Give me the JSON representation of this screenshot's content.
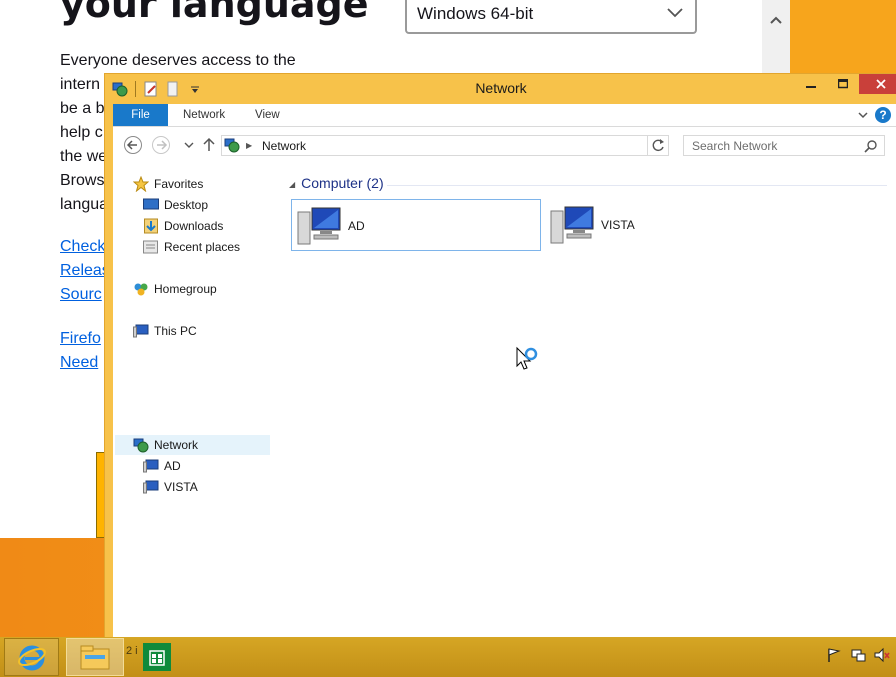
{
  "background_page": {
    "heading": "your language",
    "select_value": "Windows 64-bit",
    "paragraph_lines": [
      "Everyone deserves access to the",
      "intern",
      "be a b",
      "help c",
      "the we",
      "Brows",
      "langua"
    ],
    "links": [
      "Check",
      "Releas",
      "Sourc",
      "Firefo",
      "Need"
    ]
  },
  "window": {
    "title": "Network",
    "ribbon_tabs": {
      "file": "File",
      "network": "Network",
      "view": "View"
    },
    "help_label": "?",
    "address": {
      "location": "Network"
    },
    "search": {
      "placeholder": "Search Network"
    }
  },
  "nav_pane": {
    "favorites": "Favorites",
    "desktop": "Desktop",
    "downloads": "Downloads",
    "recent_places": "Recent places",
    "homegroup": "Homegroup",
    "this_pc": "This PC",
    "network": "Network",
    "network_children": [
      "AD",
      "VISTA"
    ]
  },
  "file_pane": {
    "group_header": "Computer (2)",
    "items": [
      {
        "name": "AD",
        "icon": "computer-icon",
        "selected": true
      },
      {
        "name": "VISTA",
        "icon": "computer-icon",
        "selected": false
      }
    ]
  },
  "taskbar": {
    "status_peek": "2 i",
    "pinned": [
      "internet-explorer-icon",
      "file-explorer-icon",
      "store-icon"
    ]
  },
  "colors": {
    "window_frame": "#f7c24a",
    "file_tab": "#1979ca",
    "close_button": "#c9403a",
    "group_header_text": "#1e3287",
    "link": "#0060df",
    "taskbar": "#c99a1f"
  }
}
